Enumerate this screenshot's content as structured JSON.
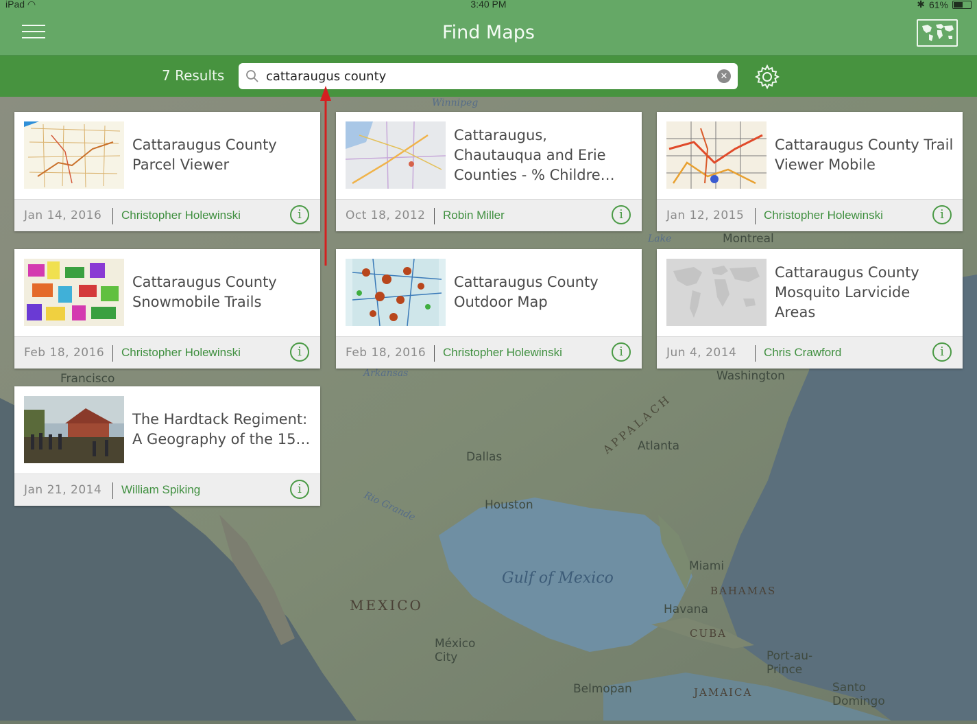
{
  "status_bar": {
    "device": "iPad",
    "time": "3:40 PM",
    "battery": "61%",
    "battery_level": 0.61
  },
  "nav": {
    "title": "Find Maps"
  },
  "search": {
    "result_count": "7 Results",
    "query": "cattaraugus county"
  },
  "map_labels": {
    "winnipeg": "Winnipeg",
    "montreal": "Montreal",
    "lake": "Lake",
    "francisco": "Francisco",
    "washington": "Washington",
    "arkansas": "Arkansas",
    "dallas": "Dallas",
    "atlanta": "Atlanta",
    "appalachian": "APPALACH",
    "houston": "Houston",
    "rio_grande": "Rio Grande",
    "gulf": "Gulf of Mexico",
    "miami": "Miami",
    "bahamas": "BAHAMAS",
    "havana": "Havana",
    "cuba": "CUBA",
    "mexico": "MEXICO",
    "mexico_city": "México City",
    "port_au_prince": "Port-au-Prince",
    "belmopan": "Belmopan",
    "jamaica": "JAMAICA",
    "santo_domingo": "Santo Domingo"
  },
  "results": [
    {
      "title": "Cattaraugus County Parcel Viewer",
      "date": "Jan 14, 2016",
      "owner": "Christopher Holewinski",
      "thumb": "parcel-map"
    },
    {
      "title": "Cattaraugus, Chautauqua and Erie Counties - % Childre…",
      "date": "Oct 18, 2012",
      "owner": "Robin Miller",
      "thumb": "street-map"
    },
    {
      "title": "Cattaraugus County Trail Viewer Mobile",
      "date": "Jan 12, 2015",
      "owner": "Christopher Holewinski",
      "thumb": "trail-map"
    },
    {
      "title": "Cattaraugus County Snowmobile Trails",
      "date": "Feb 18, 2016",
      "owner": "Christopher Holewinski",
      "thumb": "colorful-map"
    },
    {
      "title": "Cattaraugus County Outdoor Map",
      "date": "Feb 18, 2016",
      "owner": "Christopher Holewinski",
      "thumb": "outdoor-map"
    },
    {
      "title": "Cattaraugus County Mosquito Larvicide Areas",
      "date": "Jun 4, 2014",
      "owner": "Chris Crawford",
      "thumb": "world-placeholder"
    },
    {
      "title": "The Hardtack Regiment: A Geography of the 15…",
      "date": "Jan 21, 2014",
      "owner": "William Spiking",
      "thumb": "painting"
    }
  ],
  "info_glyph": "i",
  "colors": {
    "nav_green": "#65a866",
    "search_green": "#47933f",
    "owner_green": "#3f8f3f",
    "arrow_red": "#d42020"
  }
}
